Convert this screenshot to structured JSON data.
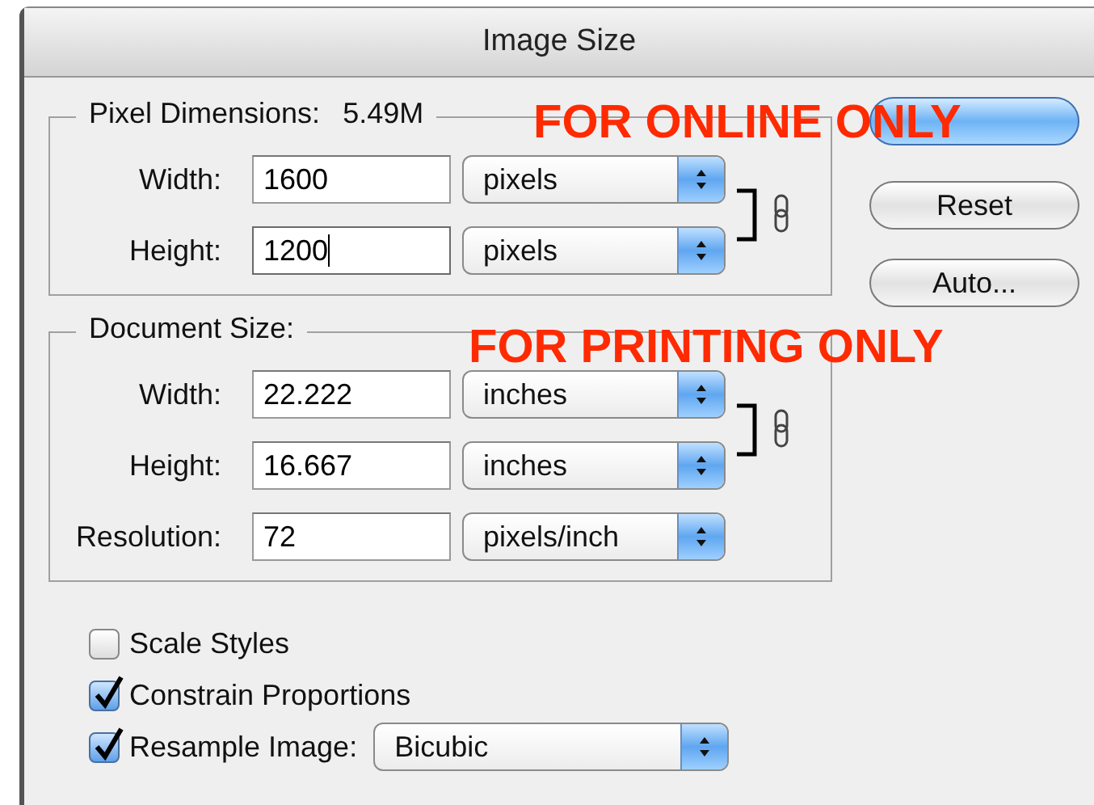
{
  "window": {
    "title": "Image Size"
  },
  "pixel_dimensions": {
    "label": "Pixel Dimensions:",
    "value": "5.49M",
    "linked": true,
    "fields": [
      {
        "label": "Width:",
        "value": "1600",
        "unit": "pixels",
        "focused": false
      },
      {
        "label": "Height:",
        "value": "1200",
        "unit": "pixels",
        "focused": true
      }
    ]
  },
  "document_size": {
    "label": "Document Size:",
    "linked": true,
    "fields": [
      {
        "label": "Width:",
        "value": "22.222",
        "unit": "inches",
        "focused": false
      },
      {
        "label": "Height:",
        "value": "16.667",
        "unit": "inches",
        "focused": false
      },
      {
        "label": "Resolution:",
        "value": "72",
        "unit": "pixels/inch",
        "focused": false
      }
    ]
  },
  "buttons": [
    {
      "kind": "default"
    },
    {
      "kind": "plain",
      "label": "Reset"
    },
    {
      "kind": "plain",
      "label": "Auto..."
    }
  ],
  "options": [
    {
      "label": "Scale Styles",
      "checked": false
    },
    {
      "label": "Constrain Proportions",
      "checked": true
    },
    {
      "label": "Resample Image:",
      "checked": true,
      "select": "Bicubic"
    }
  ],
  "annotations": [
    {
      "text": "FOR ONLINE ONLY"
    },
    {
      "text": "FOR PRINTING ONLY"
    }
  ]
}
